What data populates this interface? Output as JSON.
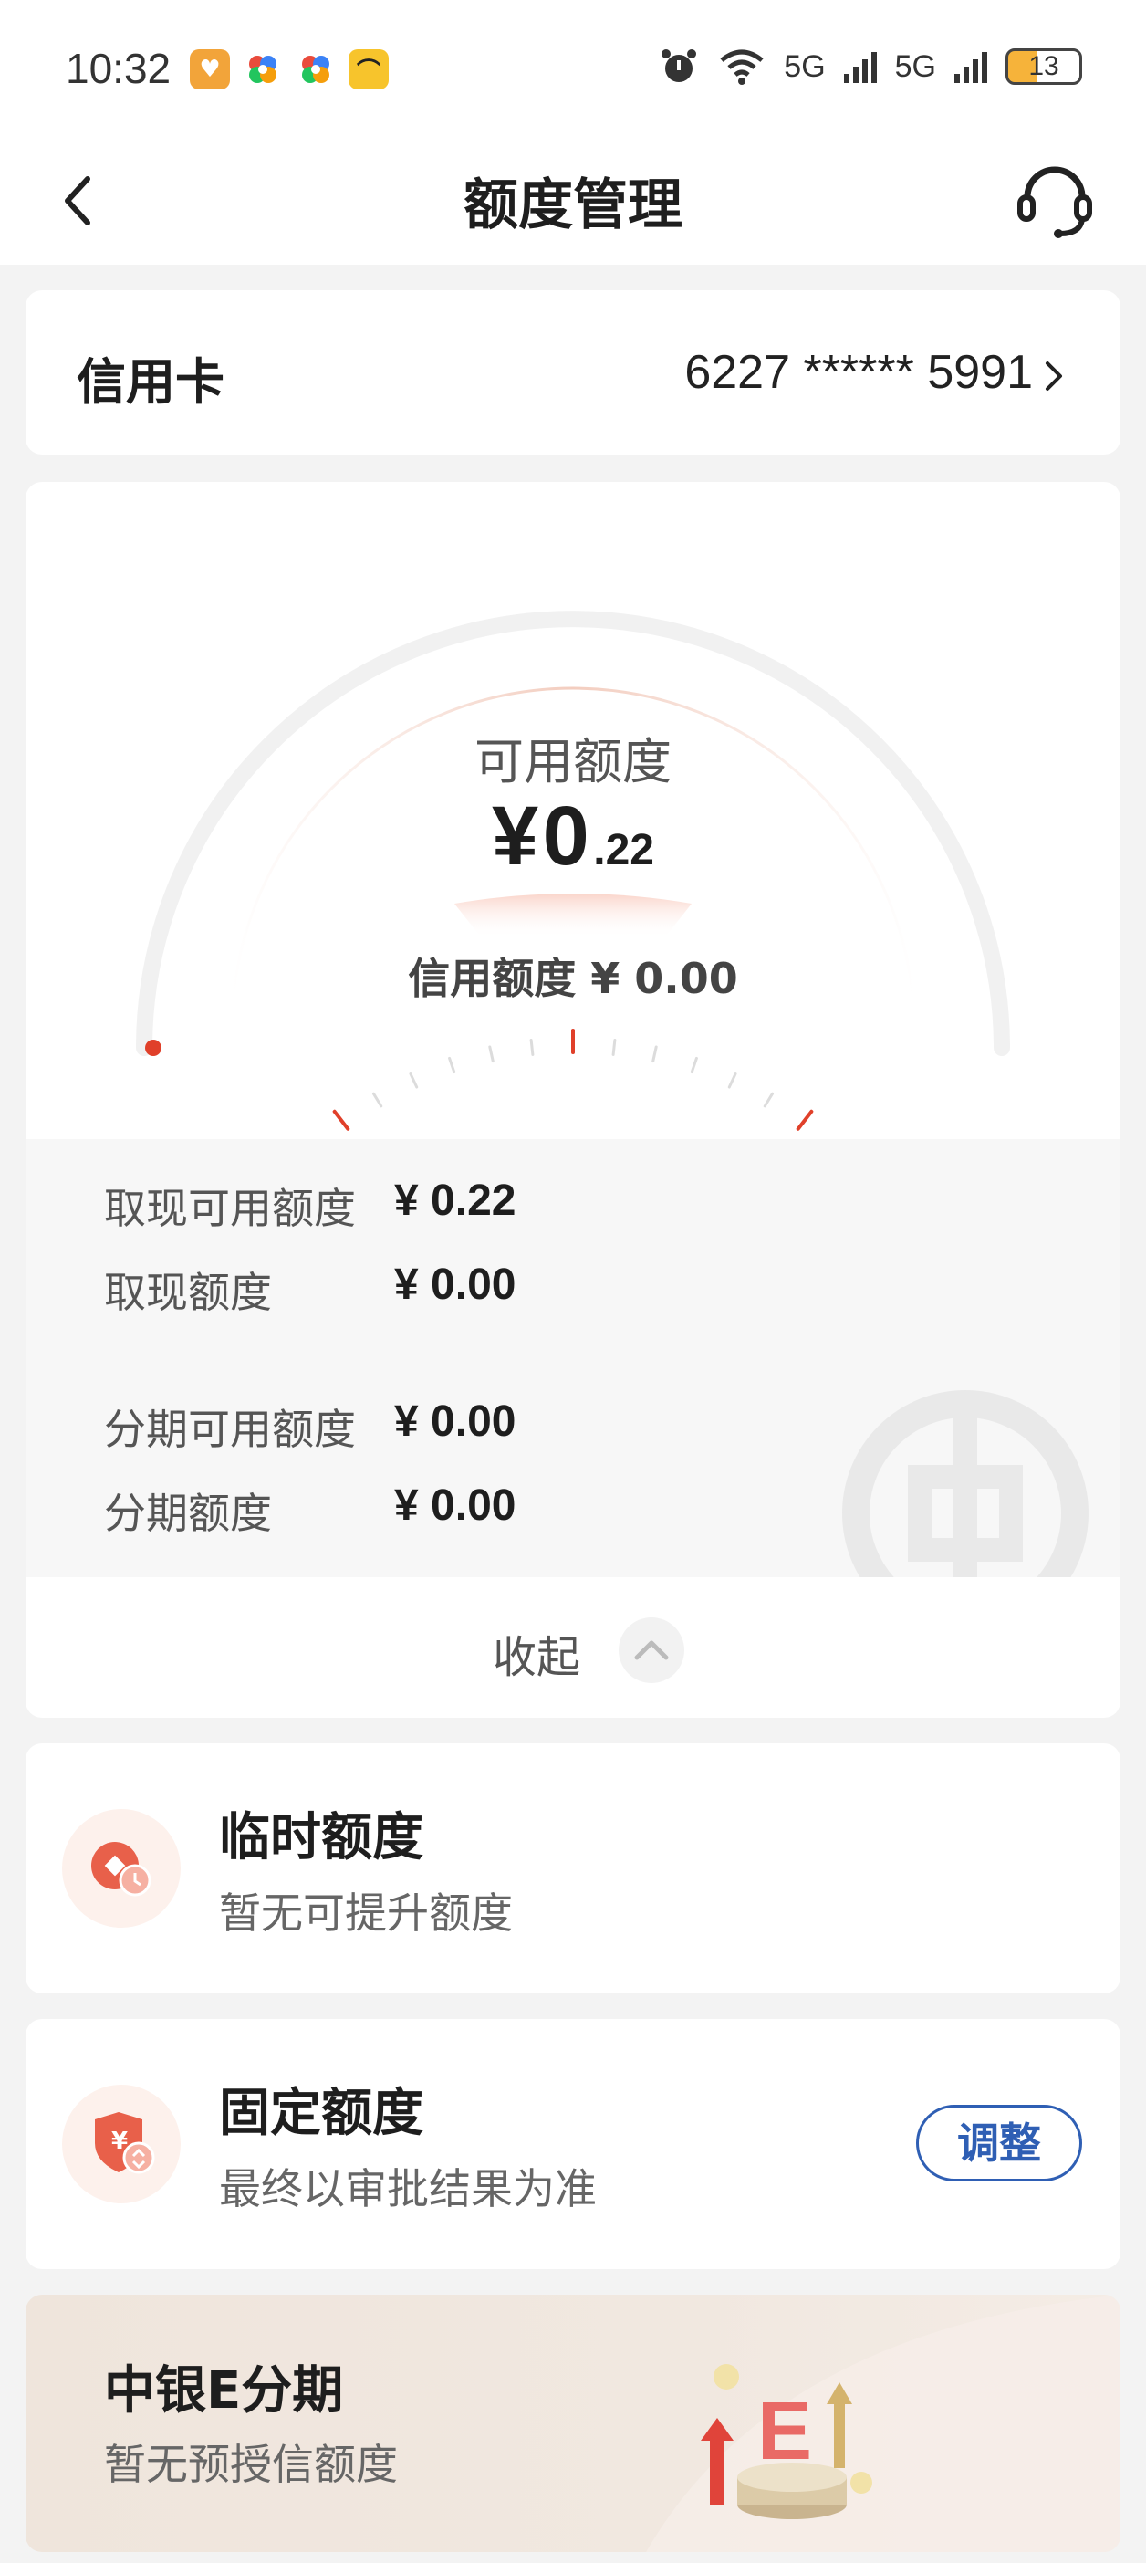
{
  "status_bar": {
    "time": "10:32",
    "network_1": "5G",
    "network_2": "5G",
    "battery": "13",
    "icons": [
      "alarm-icon",
      "wifi-icon",
      "signal-icon",
      "signal-icon",
      "battery-icon"
    ]
  },
  "header": {
    "title": "额度管理",
    "back_icon": "chevron-left-icon",
    "service_icon": "headset-icon"
  },
  "card_selector": {
    "label": "信用卡",
    "card_number": "6227 ****** 5991"
  },
  "limit": {
    "available_label": "可用额度",
    "available_currency": "¥",
    "available_integer": "0",
    "available_decimal": ".22",
    "credit_line": "信用额度 ¥ 0.00",
    "accent_color": "#e0402a"
  },
  "details": [
    {
      "label": "取现可用额度",
      "value": "¥ 0.22"
    },
    {
      "label": "取现额度",
      "value": "¥ 0.00"
    },
    {
      "label": "分期可用额度",
      "value": "¥ 0.00"
    },
    {
      "label": "分期额度",
      "value": "¥ 0.00"
    }
  ],
  "collapse": {
    "label": "收起"
  },
  "temp_limit": {
    "title": "临时额度",
    "subtitle": "暂无可提升额度"
  },
  "fixed_limit": {
    "title": "固定额度",
    "subtitle": "最终以审批结果为准",
    "button": "调整"
  },
  "promo": {
    "title": "中银E分期",
    "subtitle": "暂无预授信额度"
  }
}
